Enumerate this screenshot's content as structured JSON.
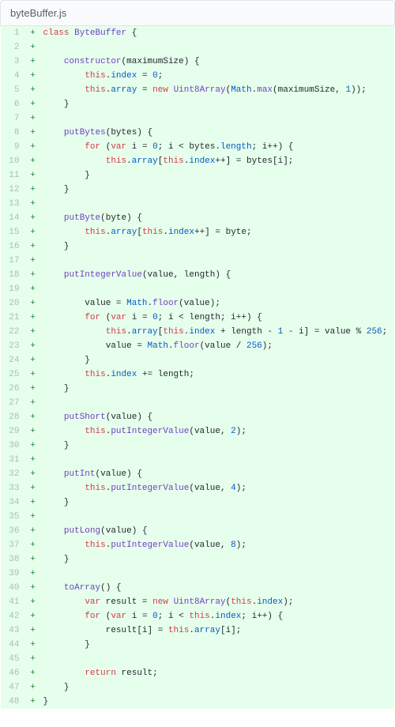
{
  "file": {
    "name": "byteBuffer.js"
  },
  "diff": {
    "marker": "+",
    "lines": [
      {
        "n": 1,
        "html": "<span class='kw'>class</span> <span class='cls'>ByteBuffer</span> {"
      },
      {
        "n": 2,
        "html": ""
      },
      {
        "n": 3,
        "html": "    <span class='fn'>constructor</span>(<span class='var'>maximumSize</span>) {"
      },
      {
        "n": 4,
        "html": "        <span class='kw'>this</span>.<span class='prop'>index</span> = <span class='num'>0</span>;"
      },
      {
        "n": 5,
        "html": "        <span class='kw'>this</span>.<span class='prop'>array</span> = <span class='kw'>new</span> <span class='cls'>Uint8Array</span>(<span class='prop'>Math</span>.<span class='fn'>max</span>(maximumSize, <span class='num'>1</span>));"
      },
      {
        "n": 6,
        "html": "    }"
      },
      {
        "n": 7,
        "html": ""
      },
      {
        "n": 8,
        "html": "    <span class='fn'>putBytes</span>(<span class='var'>bytes</span>) {"
      },
      {
        "n": 9,
        "html": "        <span class='kw'>for</span> (<span class='kw'>var</span> i = <span class='num'>0</span>; i &lt; bytes.<span class='prop'>length</span>; i++) {"
      },
      {
        "n": 10,
        "html": "            <span class='kw'>this</span>.<span class='prop'>array</span>[<span class='kw'>this</span>.<span class='prop'>index</span>++] = bytes[i];"
      },
      {
        "n": 11,
        "html": "        }"
      },
      {
        "n": 12,
        "html": "    }"
      },
      {
        "n": 13,
        "html": ""
      },
      {
        "n": 14,
        "html": "    <span class='fn'>putByte</span>(<span class='var'>byte</span>) {"
      },
      {
        "n": 15,
        "html": "        <span class='kw'>this</span>.<span class='prop'>array</span>[<span class='kw'>this</span>.<span class='prop'>index</span>++] = byte;"
      },
      {
        "n": 16,
        "html": "    }"
      },
      {
        "n": 17,
        "html": ""
      },
      {
        "n": 18,
        "html": "    <span class='fn'>putIntegerValue</span>(<span class='var'>value</span>, <span class='var'>length</span>) {"
      },
      {
        "n": 19,
        "html": ""
      },
      {
        "n": 20,
        "html": "        value = <span class='prop'>Math</span>.<span class='fn'>floor</span>(value);"
      },
      {
        "n": 21,
        "html": "        <span class='kw'>for</span> (<span class='kw'>var</span> i = <span class='num'>0</span>; i &lt; length; i++) {"
      },
      {
        "n": 22,
        "html": "            <span class='kw'>this</span>.<span class='prop'>array</span>[<span class='kw'>this</span>.<span class='prop'>index</span> + length - <span class='num'>1</span> - i] = value % <span class='num'>256</span>;"
      },
      {
        "n": 23,
        "html": "            value = <span class='prop'>Math</span>.<span class='fn'>floor</span>(value / <span class='num'>256</span>);"
      },
      {
        "n": 24,
        "html": "        }"
      },
      {
        "n": 25,
        "html": "        <span class='kw'>this</span>.<span class='prop'>index</span> += length;"
      },
      {
        "n": 26,
        "html": "    }"
      },
      {
        "n": 27,
        "html": ""
      },
      {
        "n": 28,
        "html": "    <span class='fn'>putShort</span>(<span class='var'>value</span>) {"
      },
      {
        "n": 29,
        "html": "        <span class='kw'>this</span>.<span class='fn'>putIntegerValue</span>(value, <span class='num'>2</span>);"
      },
      {
        "n": 30,
        "html": "    }"
      },
      {
        "n": 31,
        "html": ""
      },
      {
        "n": 32,
        "html": "    <span class='fn'>putInt</span>(<span class='var'>value</span>) {"
      },
      {
        "n": 33,
        "html": "        <span class='kw'>this</span>.<span class='fn'>putIntegerValue</span>(value, <span class='num'>4</span>);"
      },
      {
        "n": 34,
        "html": "    }"
      },
      {
        "n": 35,
        "html": ""
      },
      {
        "n": 36,
        "html": "    <span class='fn'>putLong</span>(<span class='var'>value</span>) {"
      },
      {
        "n": 37,
        "html": "        <span class='kw'>this</span>.<span class='fn'>putIntegerValue</span>(value, <span class='num'>8</span>);"
      },
      {
        "n": 38,
        "html": "    }"
      },
      {
        "n": 39,
        "html": ""
      },
      {
        "n": 40,
        "html": "    <span class='fn'>toArray</span>() {"
      },
      {
        "n": 41,
        "html": "        <span class='kw'>var</span> result = <span class='kw'>new</span> <span class='cls'>Uint8Array</span>(<span class='kw'>this</span>.<span class='prop'>index</span>);"
      },
      {
        "n": 42,
        "html": "        <span class='kw'>for</span> (<span class='kw'>var</span> i = <span class='num'>0</span>; i &lt; <span class='kw'>this</span>.<span class='prop'>index</span>; i++) {"
      },
      {
        "n": 43,
        "html": "            result[i] = <span class='kw'>this</span>.<span class='prop'>array</span>[i];"
      },
      {
        "n": 44,
        "html": "        }"
      },
      {
        "n": 45,
        "html": ""
      },
      {
        "n": 46,
        "html": "        <span class='kw'>return</span> result;"
      },
      {
        "n": 47,
        "html": "    }"
      },
      {
        "n": 48,
        "html": "}"
      }
    ]
  }
}
